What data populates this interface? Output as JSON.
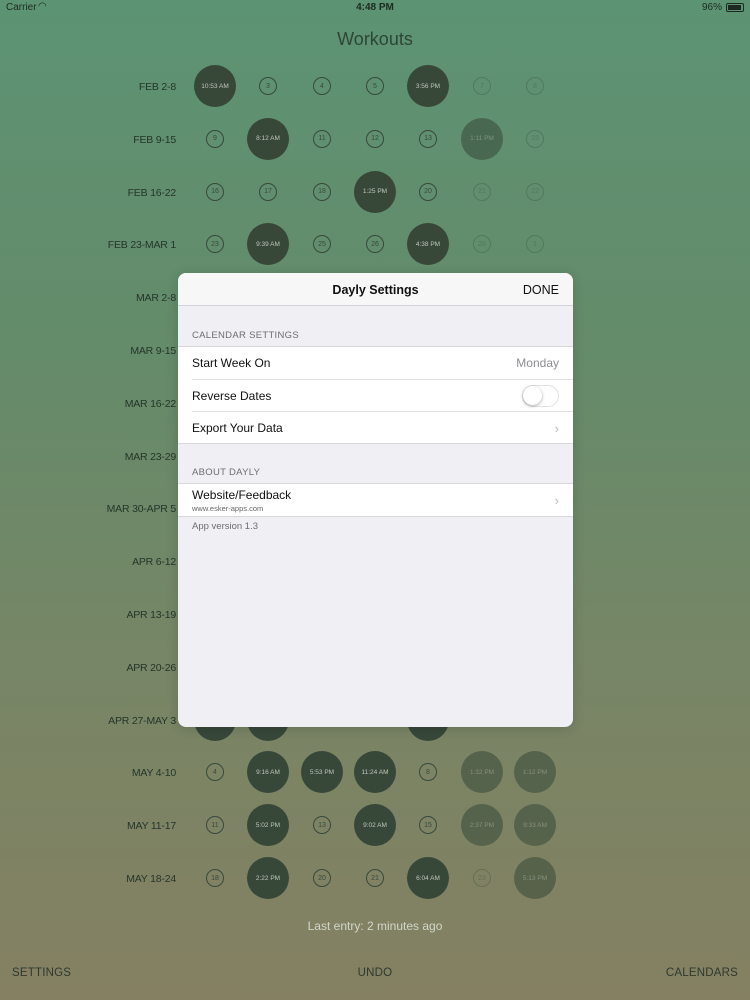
{
  "status_bar": {
    "carrier": "Carrier",
    "wifi_icon": "wifi-icon",
    "time": "4:48 PM",
    "battery": "96%"
  },
  "title": "Workouts",
  "weeks": [
    {
      "label": "FEB 2-8",
      "days": [
        {
          "text": "10:53 AM",
          "type": "big"
        },
        {
          "text": "3",
          "type": "small"
        },
        {
          "text": "4",
          "type": "small"
        },
        {
          "text": "5",
          "type": "small"
        },
        {
          "text": "3:56 PM",
          "type": "big"
        },
        {
          "text": "7",
          "type": "small",
          "faded": true
        },
        {
          "text": "8",
          "type": "small",
          "faded": true
        }
      ]
    },
    {
      "label": "FEB 9-15",
      "days": [
        {
          "text": "9",
          "type": "small"
        },
        {
          "text": "8:12 AM",
          "type": "big"
        },
        {
          "text": "11",
          "type": "small"
        },
        {
          "text": "12",
          "type": "small"
        },
        {
          "text": "13",
          "type": "small"
        },
        {
          "text": "1:11 PM",
          "type": "big",
          "faded": true
        },
        {
          "text": "15",
          "type": "small",
          "faded": true
        }
      ]
    },
    {
      "label": "FEB 16-22",
      "days": [
        {
          "text": "16",
          "type": "small"
        },
        {
          "text": "17",
          "type": "small"
        },
        {
          "text": "18",
          "type": "small"
        },
        {
          "text": "1:25 PM",
          "type": "big"
        },
        {
          "text": "20",
          "type": "small"
        },
        {
          "text": "21",
          "type": "small",
          "faded": true
        },
        {
          "text": "22",
          "type": "small",
          "faded": true
        }
      ]
    },
    {
      "label": "FEB 23-MAR 1",
      "days": [
        {
          "text": "23",
          "type": "small"
        },
        {
          "text": "9:39 AM",
          "type": "big"
        },
        {
          "text": "25",
          "type": "small"
        },
        {
          "text": "26",
          "type": "small"
        },
        {
          "text": "4:38 PM",
          "type": "big"
        },
        {
          "text": "28",
          "type": "small",
          "faded": true
        },
        {
          "text": "1",
          "type": "small",
          "faded": true
        }
      ]
    },
    {
      "label": "MAR 2-8",
      "days": []
    },
    {
      "label": "MAR 9-15",
      "days": []
    },
    {
      "label": "MAR 16-22",
      "days": []
    },
    {
      "label": "MAR 23-29",
      "days": []
    },
    {
      "label": "MAR 30-APR 5",
      "days": []
    },
    {
      "label": "APR 6-12",
      "days": []
    },
    {
      "label": "APR 13-19",
      "days": []
    },
    {
      "label": "APR 20-26",
      "days": []
    },
    {
      "label": "APR 27-MAY 3",
      "days": [
        {
          "text": "",
          "type": "big"
        },
        {
          "text": "",
          "type": "big"
        },
        {
          "text": "",
          "type": "none"
        },
        {
          "text": "",
          "type": "none"
        },
        {
          "text": "",
          "type": "big"
        },
        {
          "text": "",
          "type": "none"
        },
        {
          "text": "",
          "type": "none"
        }
      ]
    },
    {
      "label": "MAY 4-10",
      "days": [
        {
          "text": "4",
          "type": "small"
        },
        {
          "text": "9:16 AM",
          "type": "big"
        },
        {
          "text": "5:53 PM",
          "type": "big"
        },
        {
          "text": "11:24 AM",
          "type": "big"
        },
        {
          "text": "8",
          "type": "small"
        },
        {
          "text": "1:32 PM",
          "type": "big",
          "faded": true
        },
        {
          "text": "1:12 PM",
          "type": "big",
          "faded": true
        }
      ]
    },
    {
      "label": "MAY 11-17",
      "days": [
        {
          "text": "11",
          "type": "small"
        },
        {
          "text": "5:02 PM",
          "type": "big"
        },
        {
          "text": "13",
          "type": "small"
        },
        {
          "text": "9:02 AM",
          "type": "big"
        },
        {
          "text": "15",
          "type": "small"
        },
        {
          "text": "2:37 PM",
          "type": "big",
          "faded": true
        },
        {
          "text": "9:33 AM",
          "type": "big",
          "faded": true
        }
      ]
    },
    {
      "label": "MAY 18-24",
      "days": [
        {
          "text": "18",
          "type": "small"
        },
        {
          "text": "2:22 PM",
          "type": "big"
        },
        {
          "text": "20",
          "type": "small"
        },
        {
          "text": "21",
          "type": "small"
        },
        {
          "text": "6:04 AM",
          "type": "big"
        },
        {
          "text": "23",
          "type": "small",
          "faded": true
        },
        {
          "text": "5:13 PM",
          "type": "big",
          "faded": true
        }
      ]
    }
  ],
  "last_entry": "Last entry: 2 minutes ago",
  "tabbar": {
    "settings": "SETTINGS",
    "undo": "UNDO",
    "calendars": "CALENDARS"
  },
  "modal": {
    "title": "Dayly Settings",
    "done": "DONE",
    "calendar_section": "CALENDAR SETTINGS",
    "start_week_label": "Start Week On",
    "start_week_value": "Monday",
    "reverse_dates_label": "Reverse Dates",
    "reverse_dates_on": false,
    "export_label": "Export Your Data",
    "about_section": "ABOUT DAYLY",
    "website_label": "Website/Feedback",
    "website_url": "www.esker-apps.com",
    "version": "App version 1.3"
  }
}
